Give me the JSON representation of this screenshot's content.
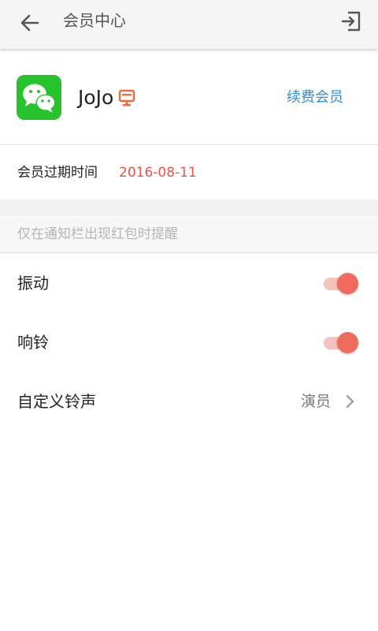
{
  "header": {
    "title": "会员中心",
    "back_icon": "arrow-left-icon",
    "exit_icon": "exit-icon"
  },
  "profile": {
    "avatar_icon": "wechat-logo-icon",
    "avatar_color": "#27c32c",
    "name": "JoJo",
    "badge_icon": "vip-badge-icon",
    "badge_color": "#ee6a3f",
    "renew_label": "续费会员",
    "renew_color": "#2b8fd6"
  },
  "membership": {
    "expire_label": "会员过期时间",
    "expire_date": "2016-08-11",
    "expire_color": "#e8564a"
  },
  "settings": {
    "section_note": "仅在通知栏出现红包时提醒",
    "vibrate": {
      "label": "振动",
      "enabled": true
    },
    "ring": {
      "label": "响铃",
      "enabled": true
    },
    "ringtone": {
      "label": "自定义铃声",
      "value": "演员",
      "icon": "chevron-right-icon"
    },
    "accent_color": "#ef6b5e"
  }
}
